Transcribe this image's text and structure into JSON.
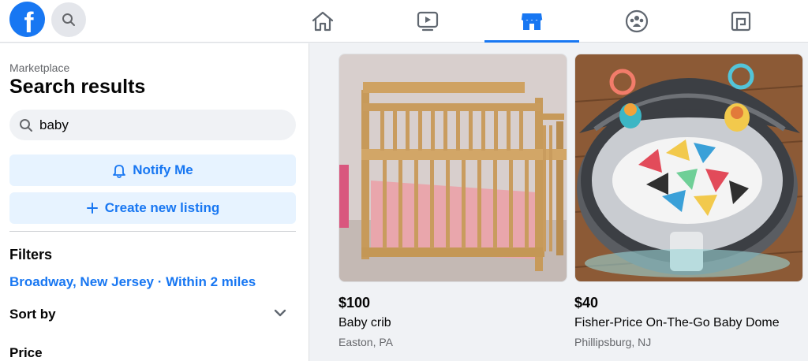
{
  "nav": {
    "logo_letter": "f",
    "tabs": [
      {
        "icon": "home-icon",
        "active": false
      },
      {
        "icon": "watch-icon",
        "active": false
      },
      {
        "icon": "marketplace-icon",
        "active": true
      },
      {
        "icon": "groups-icon",
        "active": false
      },
      {
        "icon": "gaming-icon",
        "active": false
      }
    ],
    "colors": {
      "brand": "#1877f2",
      "icon": "#606770"
    }
  },
  "sidebar": {
    "breadcrumb": "Marketplace",
    "title": "Search results",
    "search_value": "baby",
    "notify_label": "Notify Me",
    "create_label": "Create new listing",
    "filters_heading": "Filters",
    "location": "Broadway, New Jersey · Within 2 miles",
    "sort_label": "Sort by",
    "price_label": "Price"
  },
  "listings": [
    {
      "price": "$100",
      "title": "Baby crib",
      "location": "Easton, PA",
      "image": "baby-crib-photo"
    },
    {
      "price": "$40",
      "title": "Fisher-Price On-The-Go Baby Dome",
      "location": "Phillipsburg, NJ",
      "image": "baby-dome-photo"
    }
  ]
}
